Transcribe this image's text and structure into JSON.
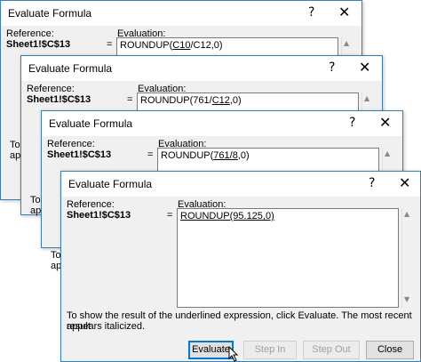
{
  "dialog_title": "Evaluate Formula",
  "help_glyph": "?",
  "close_glyph": "✕",
  "reference_label": "Reference:",
  "evaluation_label": "Evaluation:",
  "reference_value": "Sheet1!$C$13",
  "equals": "=",
  "dialogs": [
    {
      "expr": [
        {
          "text": "ROUNDUP(",
          "u": false
        },
        {
          "text": "C10",
          "u": true
        },
        {
          "text": "/C12,0)",
          "u": false
        }
      ]
    },
    {
      "expr": [
        {
          "text": "ROUNDUP(761/",
          "u": false
        },
        {
          "text": "C12",
          "u": true
        },
        {
          "text": ",0)",
          "u": false
        }
      ],
      "peek": [
        "To",
        "ap"
      ]
    },
    {
      "expr": [
        {
          "text": "ROUNDUP(",
          "u": false
        },
        {
          "text": "761/8",
          "u": true
        },
        {
          "text": ",0)",
          "u": false
        }
      ],
      "peek": [
        "To",
        "ap"
      ]
    },
    {
      "expr": [
        {
          "text": "ROUNDUP(95.125,0)",
          "u": true
        }
      ],
      "peek": [
        "To",
        "ap"
      ]
    }
  ],
  "message_line1": "To show the result of the underlined expression, click Evaluate.  The most recent result",
  "message_line2": "appears italicized.",
  "buttons": {
    "evaluate": "Evaluate",
    "step_in": "Step In",
    "step_out": "Step Out",
    "close": "Close"
  }
}
